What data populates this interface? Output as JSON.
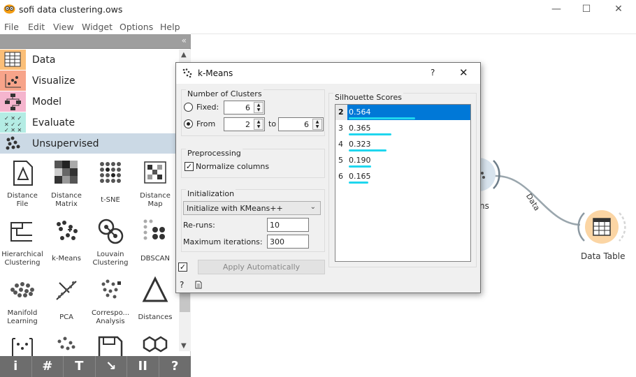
{
  "window": {
    "title": "sofi data clustering.ows"
  },
  "menu": [
    "File",
    "Edit",
    "View",
    "Widget",
    "Options",
    "Help"
  ],
  "categories": [
    {
      "label": "Data",
      "color": "#fbbf78"
    },
    {
      "label": "Visualize",
      "color": "#f7a48a"
    },
    {
      "label": "Model",
      "color": "#f5b5ce"
    },
    {
      "label": "Evaluate",
      "color": "#b4ece4"
    },
    {
      "label": "Unsupervised",
      "color": "#cbd9e5"
    }
  ],
  "widgets": [
    {
      "name": "Distance\nFile",
      "icon": "distance-file-icon"
    },
    {
      "name": "Distance\nMatrix",
      "icon": "distance-matrix-icon"
    },
    {
      "name": "t-SNE",
      "icon": "tsne-icon"
    },
    {
      "name": "Distance\nMap",
      "icon": "distance-map-icon"
    },
    {
      "name": "Hierarchical\nClustering",
      "icon": "hierarchical-clustering-icon"
    },
    {
      "name": "k-Means",
      "icon": "kmeans-icon"
    },
    {
      "name": "Louvain\nClustering",
      "icon": "louvain-icon"
    },
    {
      "name": "DBSCAN",
      "icon": "dbscan-icon"
    },
    {
      "name": "Manifold\nLearning",
      "icon": "manifold-icon"
    },
    {
      "name": "PCA",
      "icon": "pca-icon"
    },
    {
      "name": "Correspo...\nAnalysis",
      "icon": "correspondence-icon"
    },
    {
      "name": "Distances",
      "icon": "distances-icon"
    }
  ],
  "bottom_toolbar": [
    "i",
    "#",
    "T",
    "↘",
    "II",
    "?"
  ],
  "canvas": {
    "kmeans_node_label": "ns",
    "data_table_label": "Data Table",
    "link_label": "Data"
  },
  "dialog": {
    "title": "k-Means",
    "help": "?",
    "clusters": {
      "group_title": "Number of Clusters",
      "fixed_label": "Fixed:",
      "fixed_value": "6",
      "from_label": "From",
      "from_value": "2",
      "to_label": "to",
      "to_value": "6",
      "mode": "from"
    },
    "preprocessing": {
      "group_title": "Preprocessing",
      "normalize_label": "Normalize columns",
      "normalize_checked": true
    },
    "initialization": {
      "group_title": "Initialization",
      "method": "Initialize with KMeans++",
      "reruns_label": "Re-runs:",
      "reruns_value": "10",
      "maxiter_label": "Maximum iterations:",
      "maxiter_value": "300"
    },
    "apply": {
      "label": "Apply Automatically",
      "checked": true
    },
    "silhouette": {
      "group_title": "Silhouette Scores",
      "rows": [
        {
          "k": "2",
          "score": "0.564",
          "value": 0.564
        },
        {
          "k": "3",
          "score": "0.365",
          "value": 0.365
        },
        {
          "k": "4",
          "score": "0.323",
          "value": 0.323
        },
        {
          "k": "5",
          "score": "0.190",
          "value": 0.19
        },
        {
          "k": "6",
          "score": "0.165",
          "value": 0.165
        }
      ],
      "selected_index": 0
    }
  }
}
